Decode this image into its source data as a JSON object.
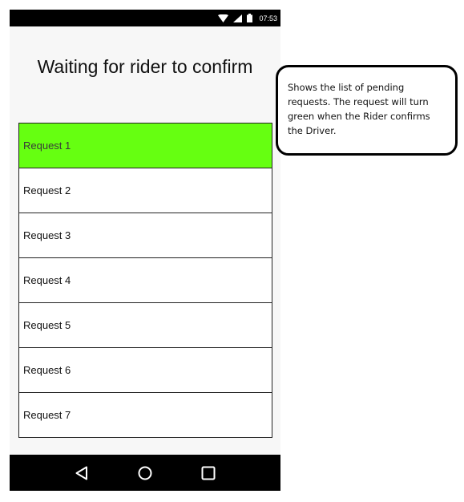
{
  "status_bar": {
    "time": "07:53",
    "icons": [
      "wifi-icon",
      "signal-icon",
      "battery-icon"
    ]
  },
  "screen": {
    "title": "Waiting for rider to confirm",
    "requests": [
      {
        "label": "Request 1",
        "confirmed": true
      },
      {
        "label": "Request 2",
        "confirmed": false
      },
      {
        "label": "Request 3",
        "confirmed": false
      },
      {
        "label": "Request 4",
        "confirmed": false
      },
      {
        "label": "Request 5",
        "confirmed": false
      },
      {
        "label": "Request 6",
        "confirmed": false
      },
      {
        "label": "Request 7",
        "confirmed": false
      }
    ]
  },
  "nav_bar": {
    "icons": [
      "back-icon",
      "home-icon",
      "recents-icon"
    ]
  },
  "annotation": {
    "text": "Shows the list of pending requests. The request will turn green when the Rider confirms the Driver."
  },
  "colors": {
    "confirmed": "#66ff11",
    "bars": "#000000",
    "background": "#f7f7f7"
  }
}
